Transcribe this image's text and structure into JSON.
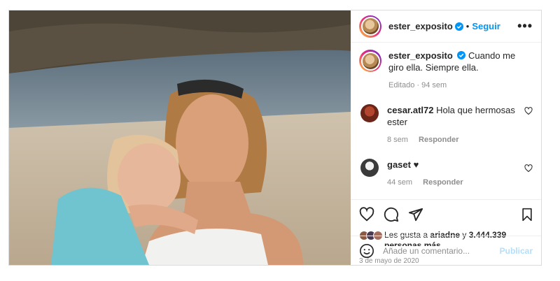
{
  "post": {
    "author": "ester_exposito",
    "follow_label": "Seguir",
    "dot": "•",
    "more_label": "•••",
    "caption": "Cuando me giro ella. Siempre ella.",
    "caption_meta": "Editado · 94 sem",
    "comments": [
      {
        "user": "cesar.atl72",
        "text": "Hola que hermosas ester",
        "time": "8 sem",
        "reply": "Responder"
      },
      {
        "user": "gaset",
        "text": "♥",
        "time": "44 sem",
        "reply": "Responder"
      }
    ],
    "likes": {
      "prefix": "Les gusta a ",
      "user": "ariadne",
      "middle": " y ",
      "count": "3.444.339",
      "suffix": "personas más"
    },
    "date": "3 de mayo de 2020",
    "add_comment": {
      "placeholder": "Añade un comentario...",
      "publish": "Publicar"
    }
  },
  "icons": [
    "verified-icon",
    "more-icon",
    "heart-icon",
    "comment-icon",
    "share-icon",
    "save-icon",
    "emoji-icon"
  ],
  "colors": {
    "link": "#0095f6",
    "muted": "#8e8e8e",
    "publish_disabled": "#b2dffc"
  }
}
